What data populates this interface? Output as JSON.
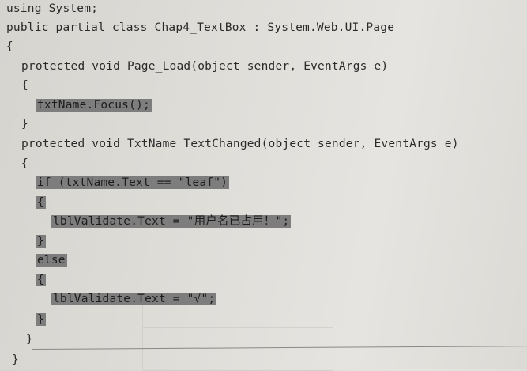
{
  "code": {
    "lines": [
      {
        "text": "using System;",
        "highlight": false
      },
      {
        "text": "public partial class Chap4_TextBox : System.Web.UI.Page",
        "highlight": false
      },
      {
        "text": "{",
        "highlight": false
      },
      {
        "text": "protected void Page_Load(object sender, EventArgs e)",
        "highlight": false
      },
      {
        "text": "{",
        "highlight": false
      },
      {
        "text": "txtName.Focus();",
        "highlight": true
      },
      {
        "text": "}",
        "highlight": false
      },
      {
        "text": "protected void TxtName_TextChanged(object sender, EventArgs e)",
        "highlight": false
      },
      {
        "text": "{",
        "highlight": false
      },
      {
        "text": "if (txtName.Text == \"leaf\")",
        "highlight": true
      },
      {
        "text": "{",
        "highlight": true
      },
      {
        "text": "lblValidate.Text = \"用户名已占用！\";",
        "highlight": true
      },
      {
        "text": "}",
        "highlight": true
      },
      {
        "text": "else",
        "highlight": true
      },
      {
        "text": "{",
        "highlight": true
      },
      {
        "text": "lblValidate.Text = \"√\";",
        "highlight": true
      },
      {
        "text": "}",
        "highlight": true
      },
      {
        "text": "}",
        "highlight": false
      },
      {
        "text": "}",
        "highlight": false
      }
    ]
  }
}
